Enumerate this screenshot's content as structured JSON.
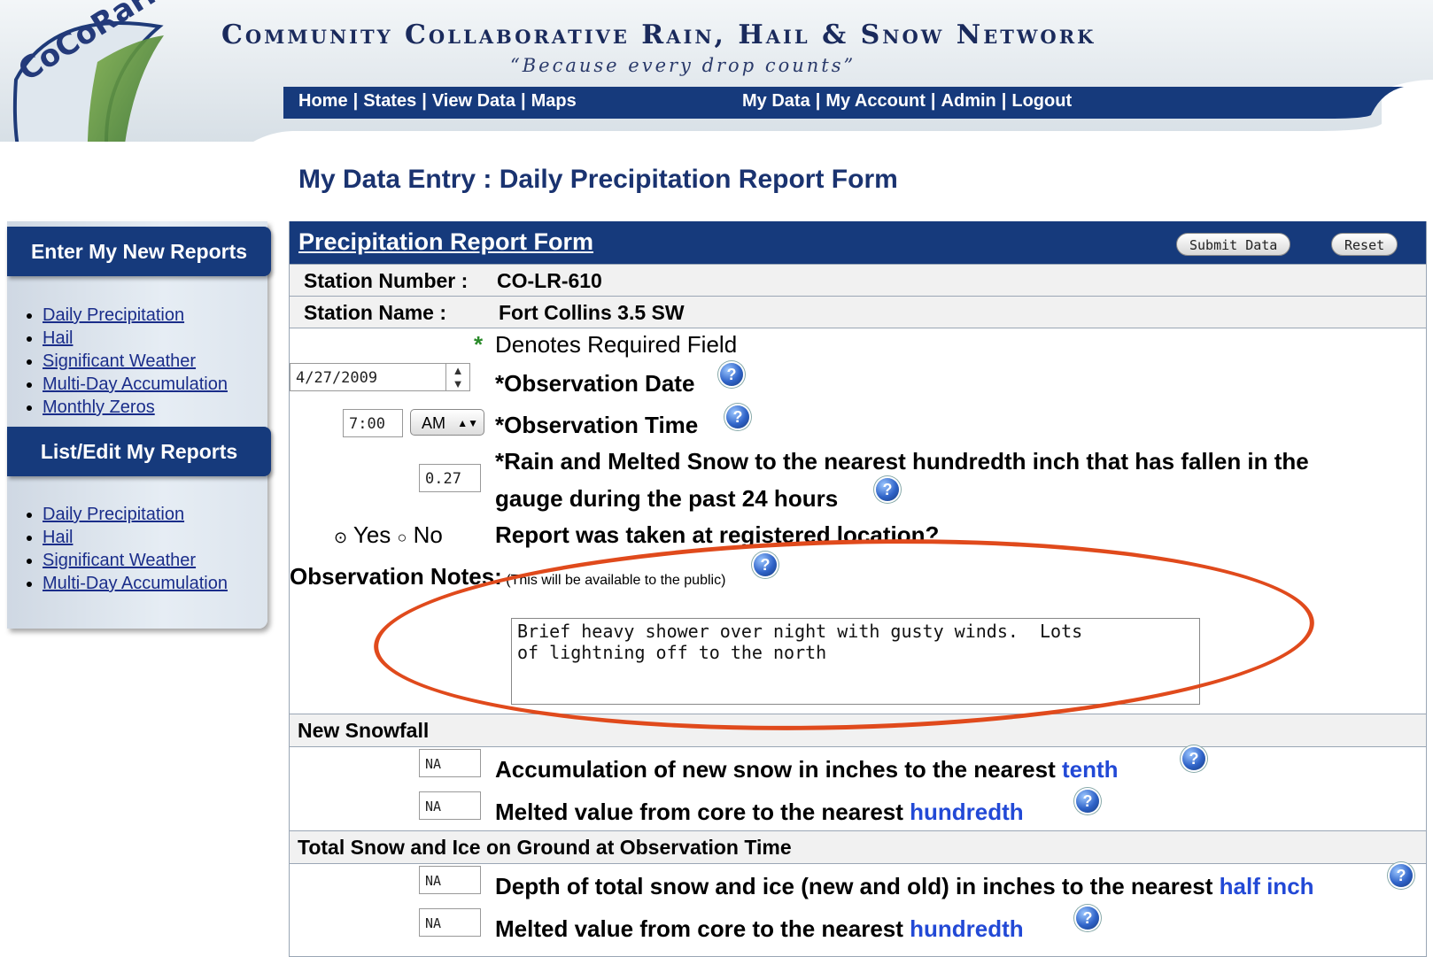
{
  "header": {
    "logo": "CoCoRaHS",
    "title": "Community Collaborative Rain, Hail & Snow Network",
    "tagline": "“Because every drop counts”",
    "nav_left": [
      "Home",
      "States",
      "View Data",
      "Maps"
    ],
    "nav_right": [
      "My Data",
      "My Account",
      "Admin",
      "Logout"
    ],
    "colors": {
      "navy": "#163a7c",
      "accent_green": "#2a8a2a",
      "annotation": "#e04a1c"
    }
  },
  "page_title": "My Data Entry : Daily Precipitation Report Form",
  "sidebar": {
    "enter_heading": "Enter My New Reports",
    "enter_items": [
      "Daily Precipitation",
      "Hail",
      "Significant Weather",
      "Multi-Day Accumulation",
      "Monthly Zeros"
    ],
    "list_heading": "List/Edit My Reports",
    "list_items": [
      "Daily Precipitation",
      "Hail",
      "Significant Weather",
      "Multi-Day Accumulation"
    ]
  },
  "form": {
    "title": "Precipitation Report Form",
    "submit_label": "Submit Data",
    "reset_label": "Reset",
    "station_number_label": "Station Number :",
    "station_number": "CO-LR-610",
    "station_name_label": "Station Name :",
    "station_name": "Fort Collins 3.5 SW",
    "required_marker": "*",
    "required_note": "Denotes Required Field",
    "obs_date_value": "4/27/2009",
    "obs_date_label": "*Observation Date",
    "obs_time_value": "7:00",
    "obs_ampm": "AM",
    "obs_time_label": "*Observation Time",
    "rain_value": "0.27",
    "rain_label_1": "*Rain and Melted Snow to the nearest hundredth inch that has fallen in the",
    "rain_label_2": "gauge during the past 24 hours",
    "yes_label": "Yes",
    "no_label": "No",
    "location_selected": "Yes",
    "location_label": "Report was taken at registered location?",
    "notes_label": "Observation Notes:",
    "notes_sub": "(This will be available to the public)",
    "notes_value": "Brief heavy shower over night with gusty winds.  Lots\nof lightning off to the north",
    "new_snow_heading": "New Snowfall",
    "new_snow_value": "NA",
    "new_snow_label": "Accumulation of new snow in inches to the nearest",
    "new_snow_unit": "tenth",
    "new_melt_value": "NA",
    "new_melt_label": "Melted value from core to the nearest",
    "new_melt_unit": "hundredth",
    "total_heading": "Total Snow and Ice on Ground at Observation Time",
    "total_depth_value": "NA",
    "total_depth_label": "Depth of total snow and ice (new and old) in inches to the nearest",
    "total_depth_unit": "half inch",
    "total_melt_value": "NA",
    "total_melt_label": "Melted value from core to the nearest",
    "total_melt_unit": "hundredth",
    "help_glyph": "?"
  }
}
